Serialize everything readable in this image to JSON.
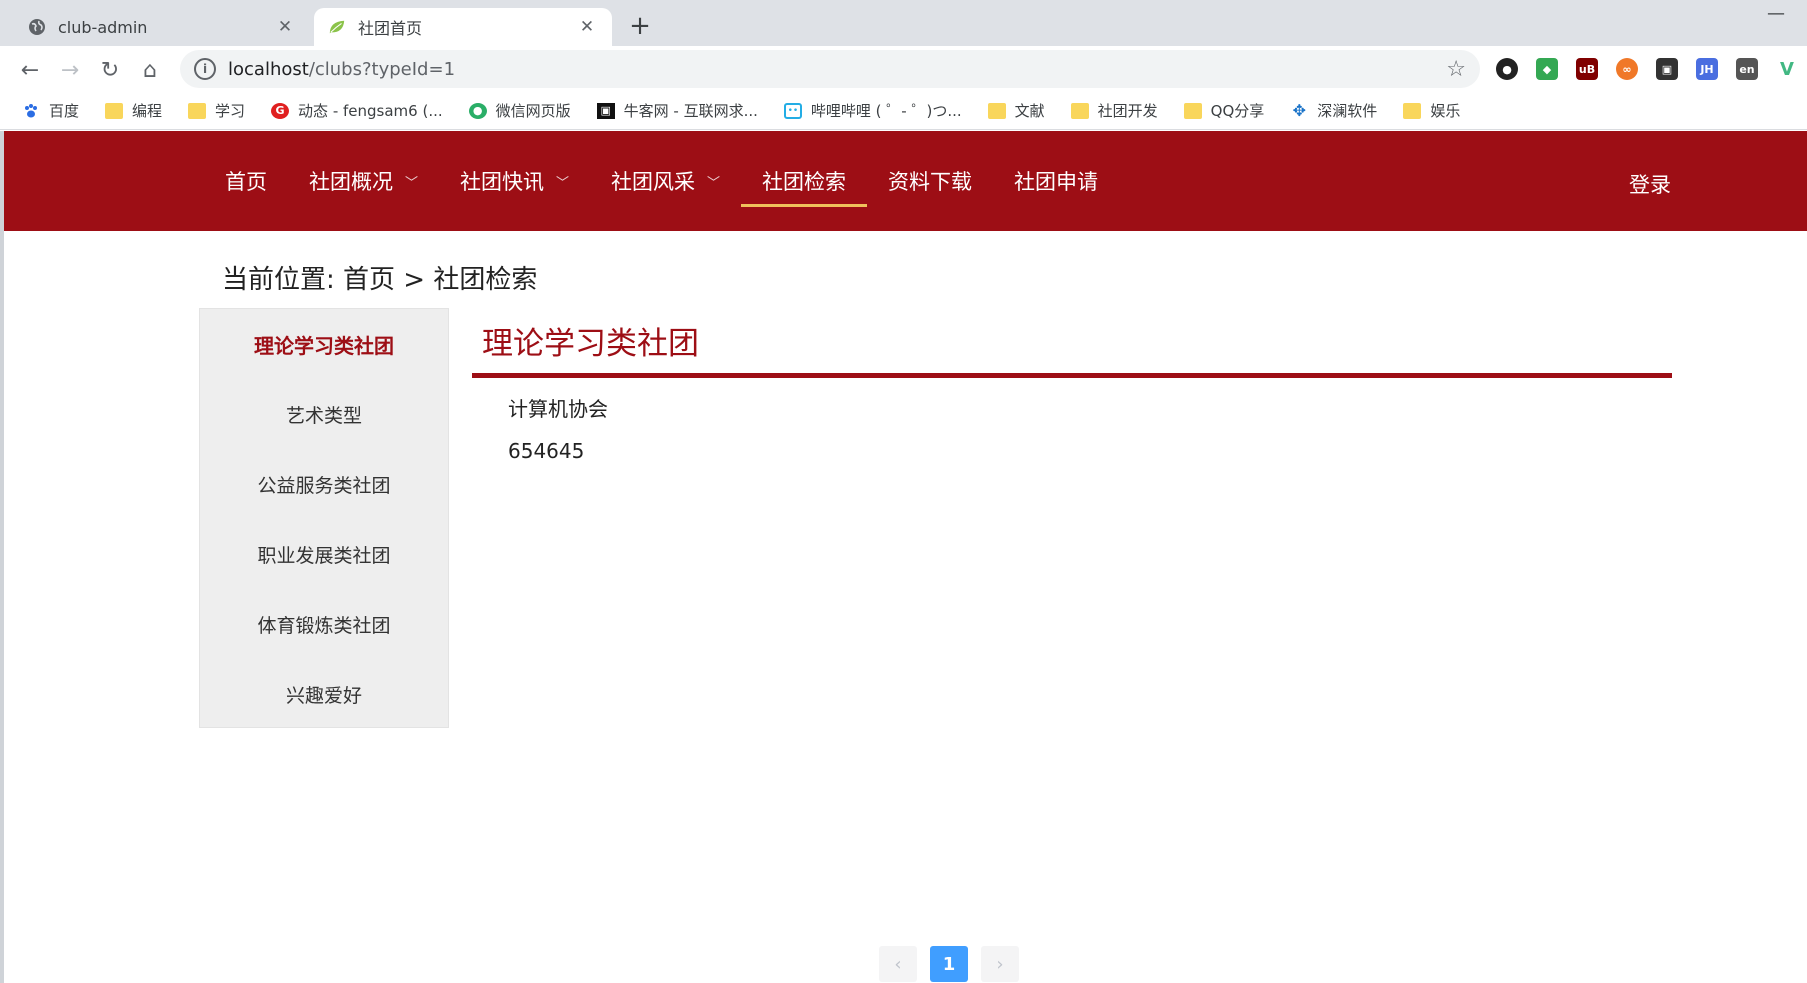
{
  "browser": {
    "tabs": [
      {
        "title": "club-admin",
        "icon": "globe-icon"
      },
      {
        "title": "社团首页",
        "icon": "leaf-icon"
      }
    ],
    "url_host": "localhost",
    "url_path": "/clubs?typeId=1",
    "bookmarks": [
      {
        "label": "百度",
        "icon": "baidu-paw-icon"
      },
      {
        "label": "编程",
        "icon": "folder-icon"
      },
      {
        "label": "学习",
        "icon": "folder-icon"
      },
      {
        "label": "动态 - fengsam6 (...",
        "icon": "red-g-icon"
      },
      {
        "label": "微信网页版",
        "icon": "wechat-icon"
      },
      {
        "label": "牛客网 - 互联网求...",
        "icon": "nowcoder-icon"
      },
      {
        "label": "哔哩哔哩 ( ゜- ゜)つ...",
        "icon": "bilibili-icon"
      },
      {
        "label": "文献",
        "icon": "folder-icon"
      },
      {
        "label": "社团开发",
        "icon": "folder-icon"
      },
      {
        "label": "QQ分享",
        "icon": "folder-icon"
      },
      {
        "label": "深澜软件",
        "icon": "compass-icon"
      },
      {
        "label": "娱乐",
        "icon": "folder-icon"
      }
    ],
    "extensions": [
      {
        "label": "",
        "color": "#222222"
      },
      {
        "label": "",
        "color": "#34a853"
      },
      {
        "label": "uB",
        "color": "#800000"
      },
      {
        "label": "∞",
        "color": "#f07828"
      },
      {
        "label": "",
        "color": "#333333"
      },
      {
        "label": "JH",
        "color": "#4a6ee0"
      },
      {
        "label": "en",
        "color": "#555555"
      },
      {
        "label": "V",
        "color": "#42b883"
      }
    ]
  },
  "site": {
    "nav": [
      {
        "label": "首页",
        "dropdown": false
      },
      {
        "label": "社团概况",
        "dropdown": true
      },
      {
        "label": "社团快讯",
        "dropdown": true
      },
      {
        "label": "社团风采",
        "dropdown": true
      },
      {
        "label": "社团检索",
        "dropdown": false,
        "active": true
      },
      {
        "label": "资料下载",
        "dropdown": false
      },
      {
        "label": "社团申请",
        "dropdown": false
      }
    ],
    "login": "登录",
    "accent_color": "#9d0e15"
  },
  "breadcrumb": "当前位置: 首页 > 社团检索",
  "sidebar": {
    "items": [
      {
        "label": "理论学习类社团",
        "active": true
      },
      {
        "label": "艺术类型"
      },
      {
        "label": "公益服务类社团"
      },
      {
        "label": "职业发展类社团"
      },
      {
        "label": "体育锻炼类社团"
      },
      {
        "label": "兴趣爱好"
      }
    ]
  },
  "main": {
    "title": "理论学习类社团",
    "clubs": [
      "计算机协会",
      "654645"
    ]
  },
  "pagination": {
    "prev": "‹",
    "current": "1",
    "next": "›"
  }
}
